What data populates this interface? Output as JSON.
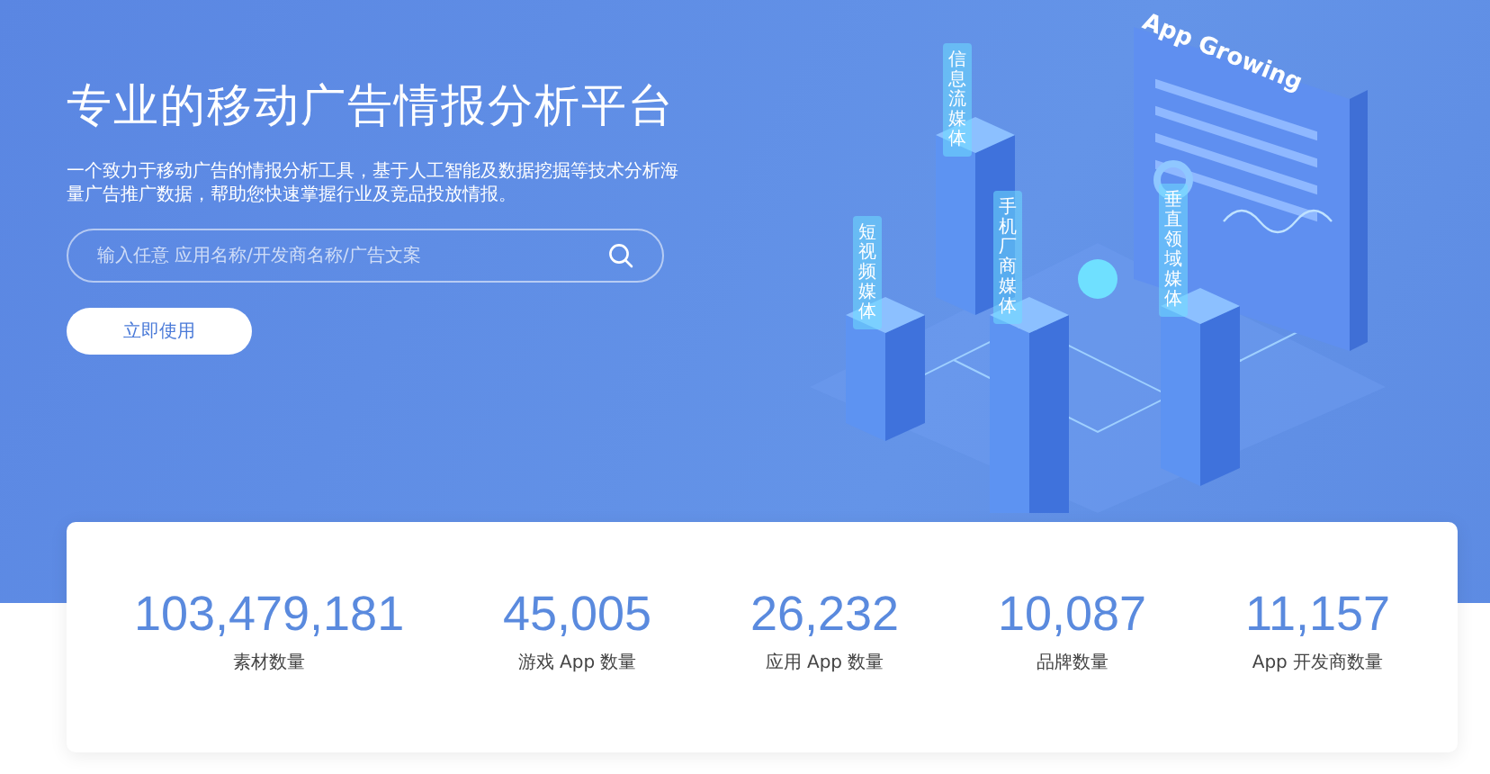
{
  "hero": {
    "title": "专业的移动广告情报分析平台",
    "description": "一个致力于移动广告的情报分析工具，基于人工智能及数据挖掘等技术分析海量广告推广数据，帮助您快速掌握行业及竞品投放情报。",
    "search": {
      "placeholder": "输入任意 应用名称/开发商名称/广告文案"
    },
    "cta": "立即使用"
  },
  "illustration": {
    "board_title": "App Growing",
    "media_tags": [
      {
        "label": "信息流媒体"
      },
      {
        "label": "短视频媒体"
      },
      {
        "label": "手机厂商媒体"
      },
      {
        "label": "垂直领域媒体"
      }
    ]
  },
  "stats": [
    {
      "value": "103,479,181",
      "label": "素材数量"
    },
    {
      "value": "45,005",
      "label": "游戏 App 数量"
    },
    {
      "value": "26,232",
      "label": "应用 App 数量"
    },
    {
      "value": "10,087",
      "label": "品牌数量"
    },
    {
      "value": "11,157",
      "label": "App 开发商数量"
    }
  ]
}
